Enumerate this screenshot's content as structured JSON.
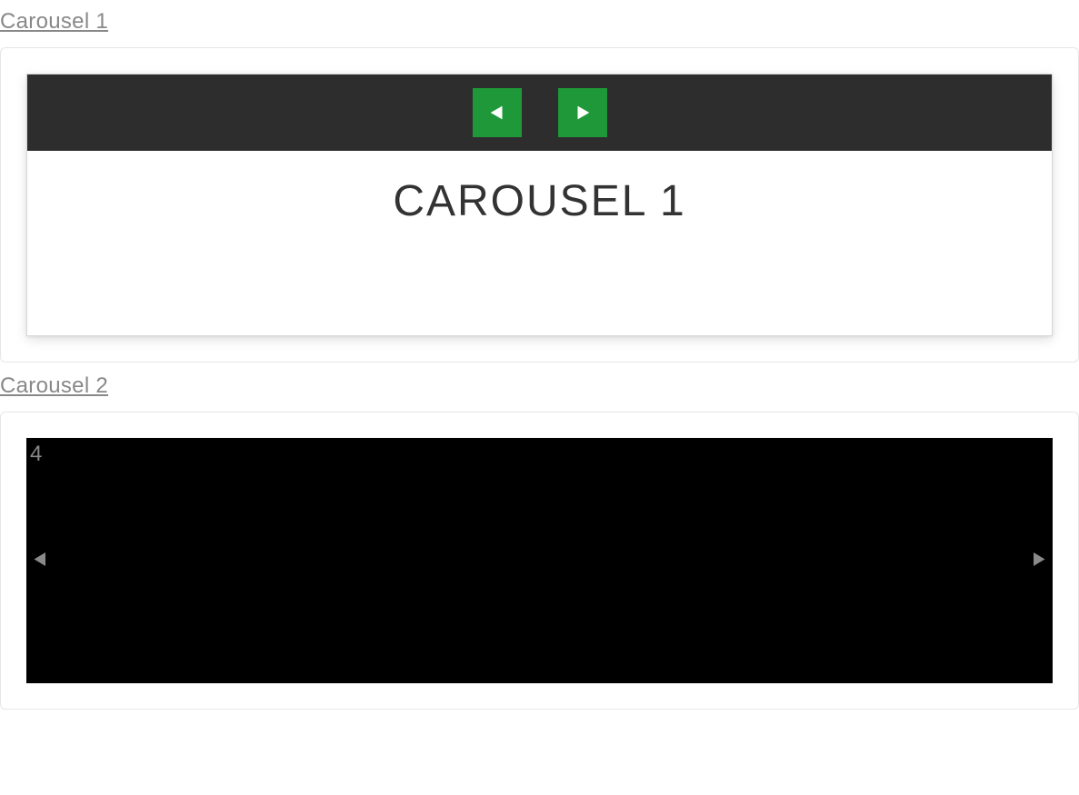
{
  "sections": {
    "carousel1": {
      "heading": "Carousel 1",
      "slide_title": "CAROUSEL 1"
    },
    "carousel2": {
      "heading": "Carousel 2",
      "slide_number": "4"
    }
  }
}
